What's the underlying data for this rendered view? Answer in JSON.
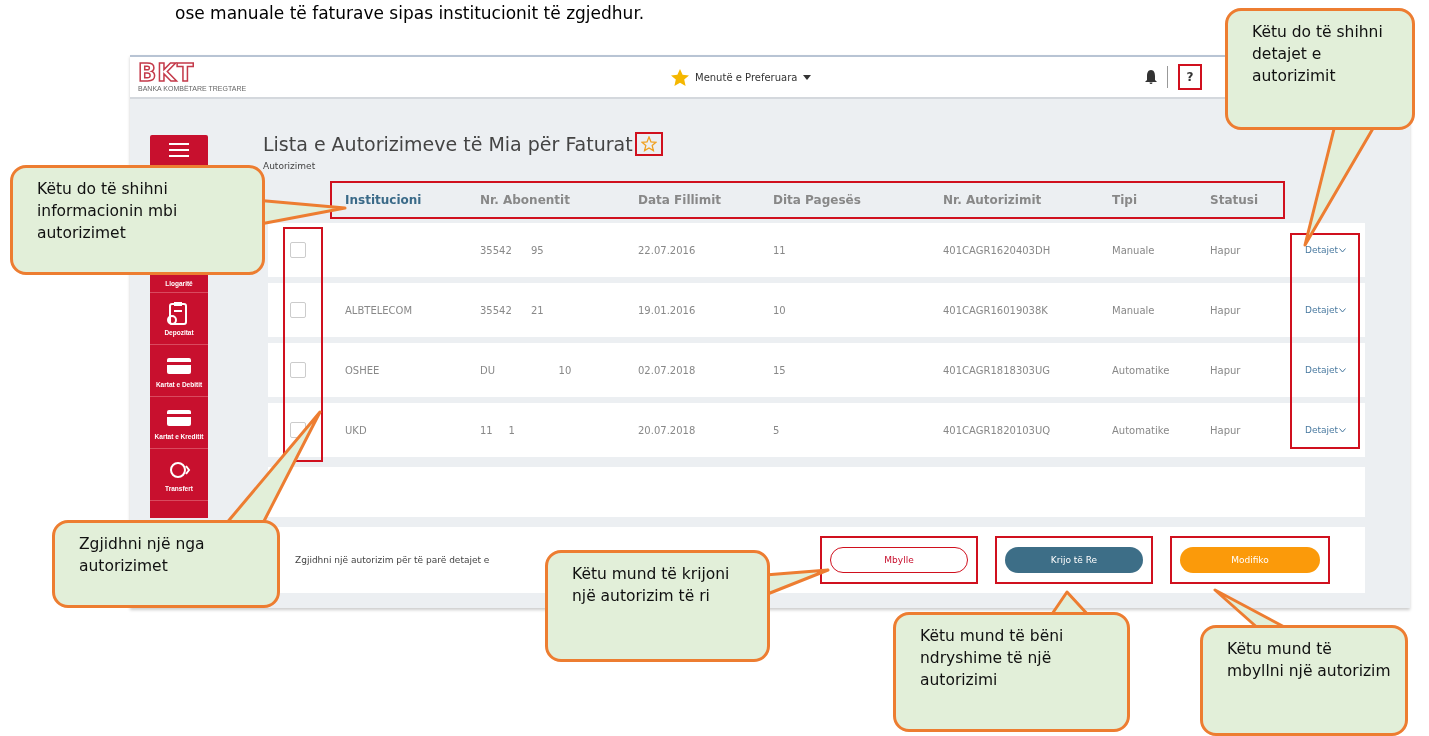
{
  "caption": "ose manuale të faturave sipas institucionit të zgjedhur.",
  "app": {
    "logo": {
      "mark": "BKT",
      "tagline": "BANKA KOMBËTARE TREGTARE"
    },
    "favorites_menu": "Menutë e Preferuara",
    "help": "?",
    "sidebar": [
      {
        "label": "Llogaritë"
      },
      {
        "label": "Depozitat"
      },
      {
        "label": "Kartat e Debitit"
      },
      {
        "label": "Kartat e Kreditit"
      },
      {
        "label": "Transfert"
      }
    ],
    "title": "Lista e Autorizimeve të Mia për Faturat",
    "favorite": false,
    "breadcrumb": "Autorizimet",
    "columns": [
      {
        "label": "Institucioni",
        "sorted": true
      },
      {
        "label": "Nr. Abonentit",
        "sorted": false
      },
      {
        "label": "Data Fillimit",
        "sorted": false
      },
      {
        "label": "Dita Pagesës",
        "sorted": false
      },
      {
        "label": "Nr. Autorizimit",
        "sorted": false
      },
      {
        "label": "Tipi",
        "sorted": false
      },
      {
        "label": "Statusi",
        "sorted": false
      }
    ],
    "rows": [
      {
        "checked": false,
        "cells": [
          "",
          "35542      95",
          "22.07.2016",
          "11",
          "401CAGR1620403DH",
          "Manuale",
          "Hapur"
        ],
        "details": "Detajet"
      },
      {
        "checked": false,
        "cells": [
          "ALBTELECOM",
          "35542      21",
          "19.01.2016",
          "10",
          "401CAGR16019038K",
          "Manuale",
          "Hapur"
        ],
        "details": "Detajet"
      },
      {
        "checked": false,
        "cells": [
          "OSHEE",
          "DU                    10",
          "02.07.2018",
          "15",
          "401CAGR1818303UG",
          "Automatike",
          "Hapur"
        ],
        "details": "Detajet"
      },
      {
        "checked": false,
        "cells": [
          "UKD",
          "11     1",
          "20.07.2018",
          "5",
          "401CAGR1820103UQ",
          "Automatike",
          "Hapur"
        ],
        "details": "Detajet"
      }
    ],
    "footer_hint": "Zgjidhni një autorizim për të parë detajet e",
    "buttons": [
      {
        "label": "Mbylle",
        "kind": "outline"
      },
      {
        "label": "Krijo të Re",
        "kind": "primary"
      },
      {
        "label": "Modifiko",
        "kind": "accent"
      }
    ]
  },
  "callouts": [
    {
      "text": "Këtu do të shihni informacionin mbi autorizimet"
    },
    {
      "text": "Këtu do të shihni detajet e autorizimit"
    },
    {
      "text": "Zgjidhni një nga autorizimet"
    },
    {
      "text": "Këtu mund të krijoni një autorizim të ri"
    },
    {
      "text": "Këtu mund të bëni ndryshime të një autorizimi"
    },
    {
      "text": "Këtu mund të mbyllni një autorizim"
    }
  ]
}
